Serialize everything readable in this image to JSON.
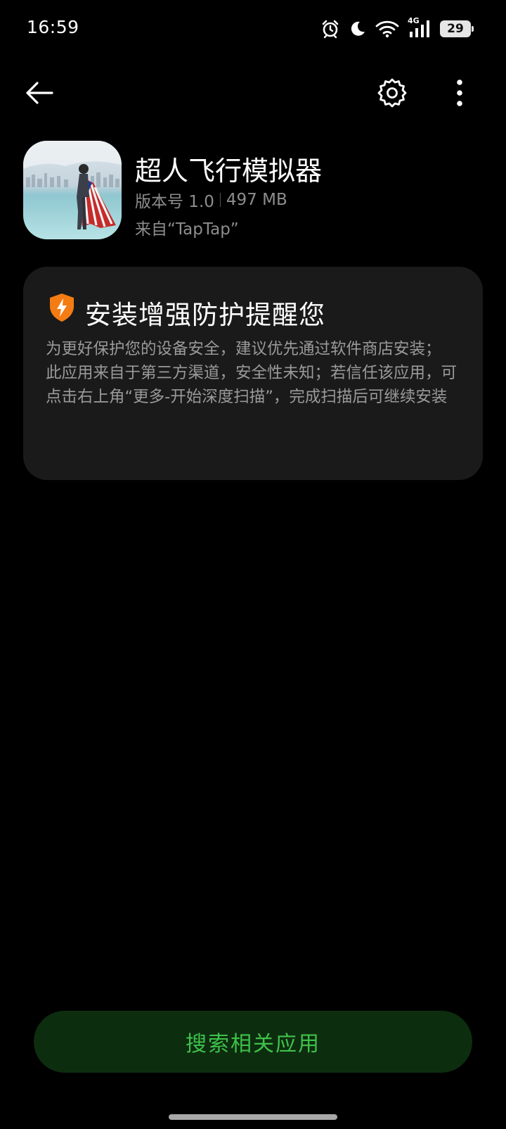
{
  "status_bar": {
    "time": "16:59",
    "network_type": "4G",
    "battery_level": "29",
    "icons": [
      "alarm-icon",
      "moon-icon",
      "wifi-icon",
      "signal-icon",
      "battery-icon"
    ]
  },
  "toolbar": {
    "back_icon": "arrow-left-icon",
    "settings_icon": "gear-icon",
    "more_icon": "vertical-dots-icon"
  },
  "app": {
    "name": "超人飞行模拟器",
    "version": "版本号 1.0",
    "size": "497 MB",
    "source": "来自“TapTap”"
  },
  "warning": {
    "icon": "shield-bolt-icon",
    "title": "安装增强防护提醒您",
    "paragraph_1": "为更好保护您的设备安全，建议优先通过软件商店安装；",
    "paragraph_2": "此应用来自于第三方渠道，安全性未知；若信任该应用，可点击右上角“更多-开始深度扫描”，完成扫描后可继续安装"
  },
  "actions": {
    "search_related_label": "搜索相关应用"
  },
  "colors": {
    "background": "#000000",
    "card_background": "#1a1a1a",
    "accent_green": "#3ec24a",
    "button_background": "#0d2d0f",
    "shield_orange": "#f57c12"
  }
}
